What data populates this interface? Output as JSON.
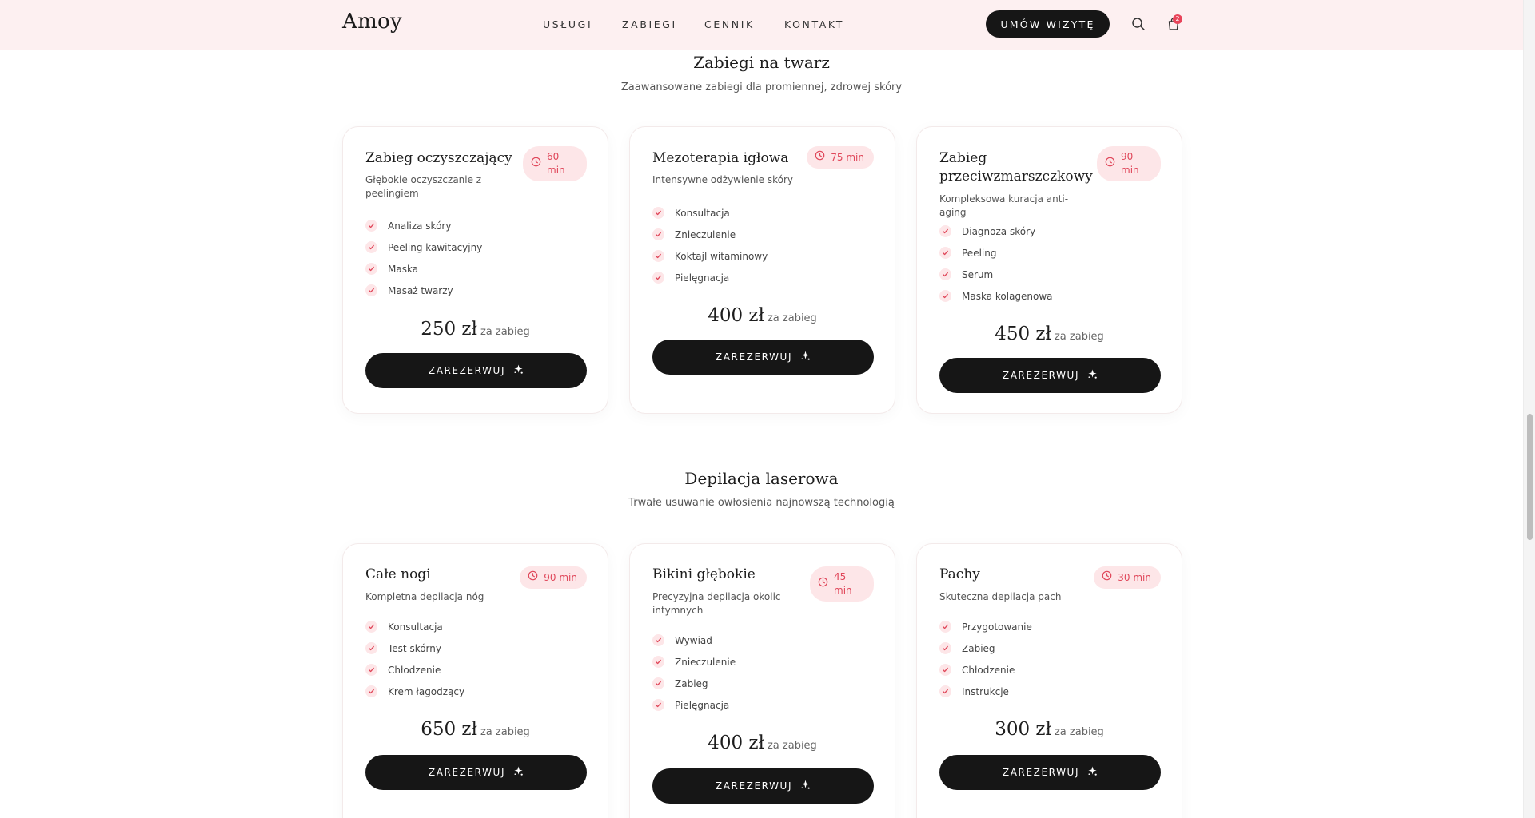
{
  "brand": {
    "logo": "Amoy"
  },
  "nav": {
    "items": [
      {
        "label": "USŁUGI"
      },
      {
        "label": "ZABIEGI"
      },
      {
        "label": "CENNIK"
      },
      {
        "label": "KONTAKT"
      }
    ],
    "cta_label": "UMÓW WIZYTĘ",
    "cart_count": "2"
  },
  "colors": {
    "header_bg": "#fdf0f1",
    "accent": "#e0475a",
    "accent_soft": "#fde6e8",
    "dark": "#161616"
  },
  "icons": {
    "search": "search-icon",
    "cart": "shopping-bag-icon",
    "duration": "clock-icon",
    "feature": "check-icon",
    "book": "sparkle-icon"
  },
  "sections": [
    {
      "title": "Zabiegi na twarz",
      "subtitle": "Zaawansowane zabiegi dla promiennej, zdrowej skóry",
      "cards": [
        {
          "title": "Zabieg oczyszczający",
          "duration": "60 min",
          "description": "Głębokie oczyszczanie z peelingiem",
          "features": [
            "Analiza skóry",
            "Peeling kawitacyjny",
            "Maska",
            "Masaż twarzy"
          ],
          "price": "250 zł",
          "price_unit": "za zabieg",
          "cta": "ZAREZERWUJ"
        },
        {
          "title": "Mezoterapia igłowa",
          "duration": "75 min",
          "description": "Intensywne odżywienie skóry",
          "features": [
            "Konsultacja",
            "Znieczulenie",
            "Koktajl witaminowy",
            "Pielęgnacja"
          ],
          "price": "400 zł",
          "price_unit": "za zabieg",
          "cta": "ZAREZERWUJ"
        },
        {
          "title": "Zabieg przeciwzmarszczkowy",
          "duration": "90 min",
          "description": "Kompleksowa kuracja anti-aging",
          "features": [
            "Diagnoza skóry",
            "Peeling",
            "Serum",
            "Maska kolagenowa"
          ],
          "price": "450 zł",
          "price_unit": "za zabieg",
          "cta": "ZAREZERWUJ"
        }
      ]
    },
    {
      "title": "Depilacja laserowa",
      "subtitle": "Trwałe usuwanie owłosienia najnowszą technologią",
      "cards": [
        {
          "title": "Całe nogi",
          "duration": "90 min",
          "description": "Kompletna depilacja nóg",
          "features": [
            "Konsultacja",
            "Test skórny",
            "Chłodzenie",
            "Krem łagodzący"
          ],
          "price": "650 zł",
          "price_unit": "za zabieg",
          "cta": "ZAREZERWUJ"
        },
        {
          "title": "Bikini głębokie",
          "duration": "45 min",
          "description": "Precyzyjna depilacja okolic intymnych",
          "features": [
            "Wywiad",
            "Znieczulenie",
            "Zabieg",
            "Pielęgnacja"
          ],
          "price": "400 zł",
          "price_unit": "za zabieg",
          "cta": "ZAREZERWUJ"
        },
        {
          "title": "Pachy",
          "duration": "30 min",
          "description": "Skuteczna depilacja pach",
          "features": [
            "Przygotowanie",
            "Zabieg",
            "Chłodzenie",
            "Instrukcje"
          ],
          "price": "300 zł",
          "price_unit": "za zabieg",
          "cta": "ZAREZERWUJ"
        }
      ]
    }
  ]
}
